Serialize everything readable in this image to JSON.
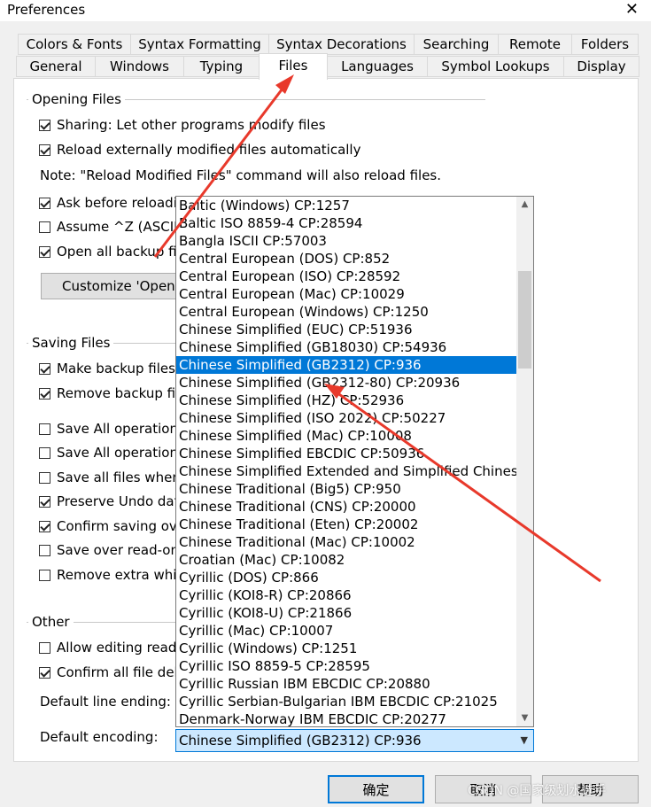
{
  "window": {
    "title": "Preferences",
    "close_glyph": "✕"
  },
  "tabs_row1": [
    "Colors & Fonts",
    "Syntax Formatting",
    "Syntax Decorations",
    "Searching",
    "Remote",
    "Folders"
  ],
  "tabs_row2": [
    "General",
    "Windows",
    "Typing",
    "Files",
    "Languages",
    "Symbol Lookups",
    "Display"
  ],
  "opening_files": {
    "title": "Opening Files",
    "sharing": "Sharing: Let other programs modify files",
    "reload": "Reload externally modified files automatically",
    "note": "Note: \"Reload Modified Files\" command will also reload files.",
    "ask_before": "Ask before reloadi",
    "assume": "Assume ^Z (ASCII",
    "open_backup": "Open all backup fil",
    "customize_btn": "Customize 'Open'"
  },
  "saving_files": {
    "title": "Saving Files",
    "make_backup": "Make backup files",
    "remove_backup": "Remove backup fil",
    "save_all_1": "Save All operation",
    "save_all_2": "Save All operation",
    "save_all_files": "Save all files when",
    "preserve_undo": "Preserve Undo dat",
    "confirm_saving": "Confirm saving ove",
    "save_readonly": "Save over read-on",
    "remove_extra": "Remove extra whit"
  },
  "other": {
    "title": "Other",
    "allow_editing": "Allow editing read",
    "confirm_delete": "Confirm all file dele",
    "default_line_ending": "Default line ending:",
    "default_encoding": "Default encoding:"
  },
  "encoding_list": [
    "Baltic (Windows)  CP:1257",
    "Baltic ISO 8859-4   CP:28594",
    "Bangla ISCII  CP:57003",
    "Central European (DOS)  CP:852",
    "Central European (ISO)  CP:28592",
    "Central European (Mac)  CP:10029",
    "Central European (Windows)  CP:1250",
    "Chinese Simplified (EUC)  CP:51936",
    "Chinese Simplified (GB18030)  CP:54936",
    "Chinese Simplified (GB2312)  CP:936",
    "Chinese Simplified (GB2312-80)  CP:20936",
    "Chinese Simplified (HZ)  CP:52936",
    "Chinese Simplified (ISO 2022)  CP:50227",
    "Chinese Simplified (Mac)  CP:10008",
    "Chinese Simplified EBCDIC  CP:50936",
    "Chinese Simplified Extended and Simplified Chinese",
    "Chinese Traditional (Big5)  CP:950",
    "Chinese Traditional (CNS)  CP:20000",
    "Chinese Traditional (Eten)  CP:20002",
    "Chinese Traditional (Mac)  CP:10002",
    "Croatian (Mac)  CP:10082",
    "Cyrillic (DOS)  CP:866",
    "Cyrillic (KOI8-R)  CP:20866",
    "Cyrillic (KOI8-U)  CP:21866",
    "Cyrillic (Mac)  CP:10007",
    "Cyrillic (Windows)  CP:1251",
    "Cyrillic ISO 8859-5   CP:28595",
    "Cyrillic Russian IBM EBCDIC  CP:20880",
    "Cyrillic Serbian-Bulgarian IBM EBCDIC  CP:21025",
    "Denmark-Norway IBM EBCDIC  CP:20277"
  ],
  "selected_index": 9,
  "combo_value": "Chinese Simplified (GB2312)  CP:936",
  "buttons": {
    "ok": "确定",
    "cancel": "取消",
    "help": "帮助"
  },
  "watermark": "CSDN @国家级划水选手",
  "colors": {
    "accent": "#0078d7",
    "annotation_arrow": "#e8392b"
  },
  "icons": {
    "close": "close-icon",
    "up": "chevron-up-icon",
    "down": "chevron-down-icon",
    "check": "checkmark-icon"
  }
}
